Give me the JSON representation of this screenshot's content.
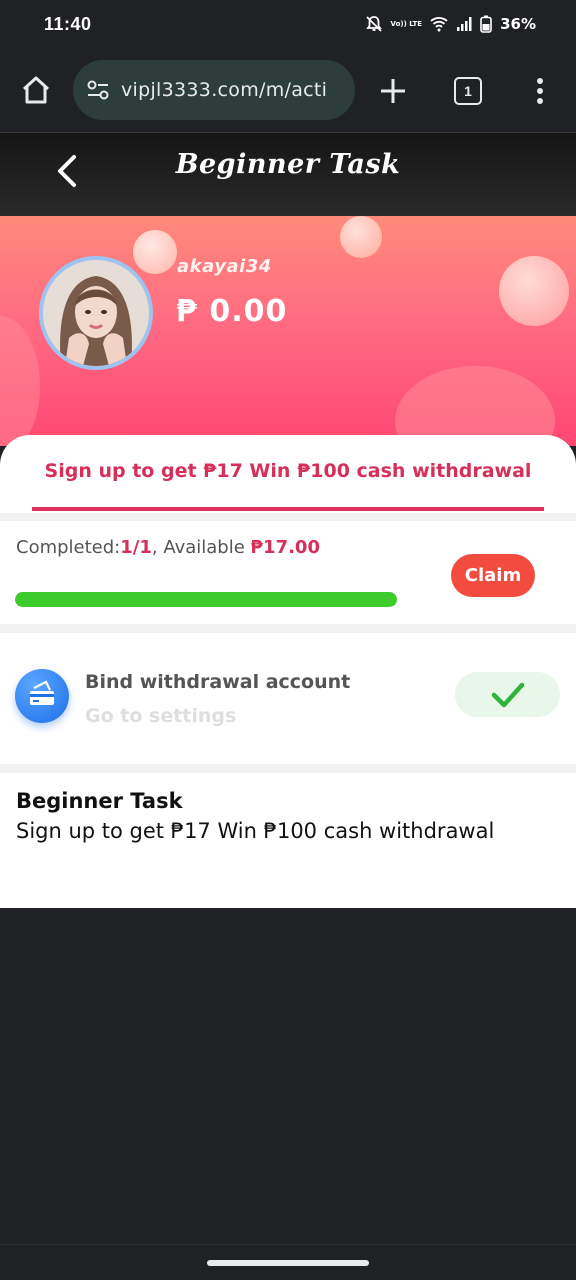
{
  "status_bar": {
    "time": "11:40",
    "volte_label": "Vo)) LTE",
    "battery": "36%"
  },
  "browser": {
    "url": "vipjl3333.com/m/acti",
    "tab_count": "1"
  },
  "header": {
    "title": "Beginner Task"
  },
  "profile": {
    "username": "akayai34",
    "balance": "₱ 0.00"
  },
  "tabs": [
    {
      "label": "Sign up to get ₱17  Win ₱100 cash withdrawal",
      "active": true
    }
  ],
  "progress_card": {
    "completed_label": "Completed:",
    "completed_value": "1/1",
    "available_label": ", Available ",
    "available_value": "₱17.00",
    "progress_fraction": 1.0,
    "claim_label": "Claim"
  },
  "bind_card": {
    "title": "Bind withdrawal account",
    "subtitle": "Go to settings",
    "status": "done"
  },
  "description": {
    "title": "Beginner Task",
    "text": "Sign up to get ₱17 Win ₱100 cash withdrawal"
  },
  "colors": {
    "accent": "#d6305a",
    "claim": "#f14c3d",
    "progress": "#3bcb2a",
    "check": "#2fb43a"
  }
}
